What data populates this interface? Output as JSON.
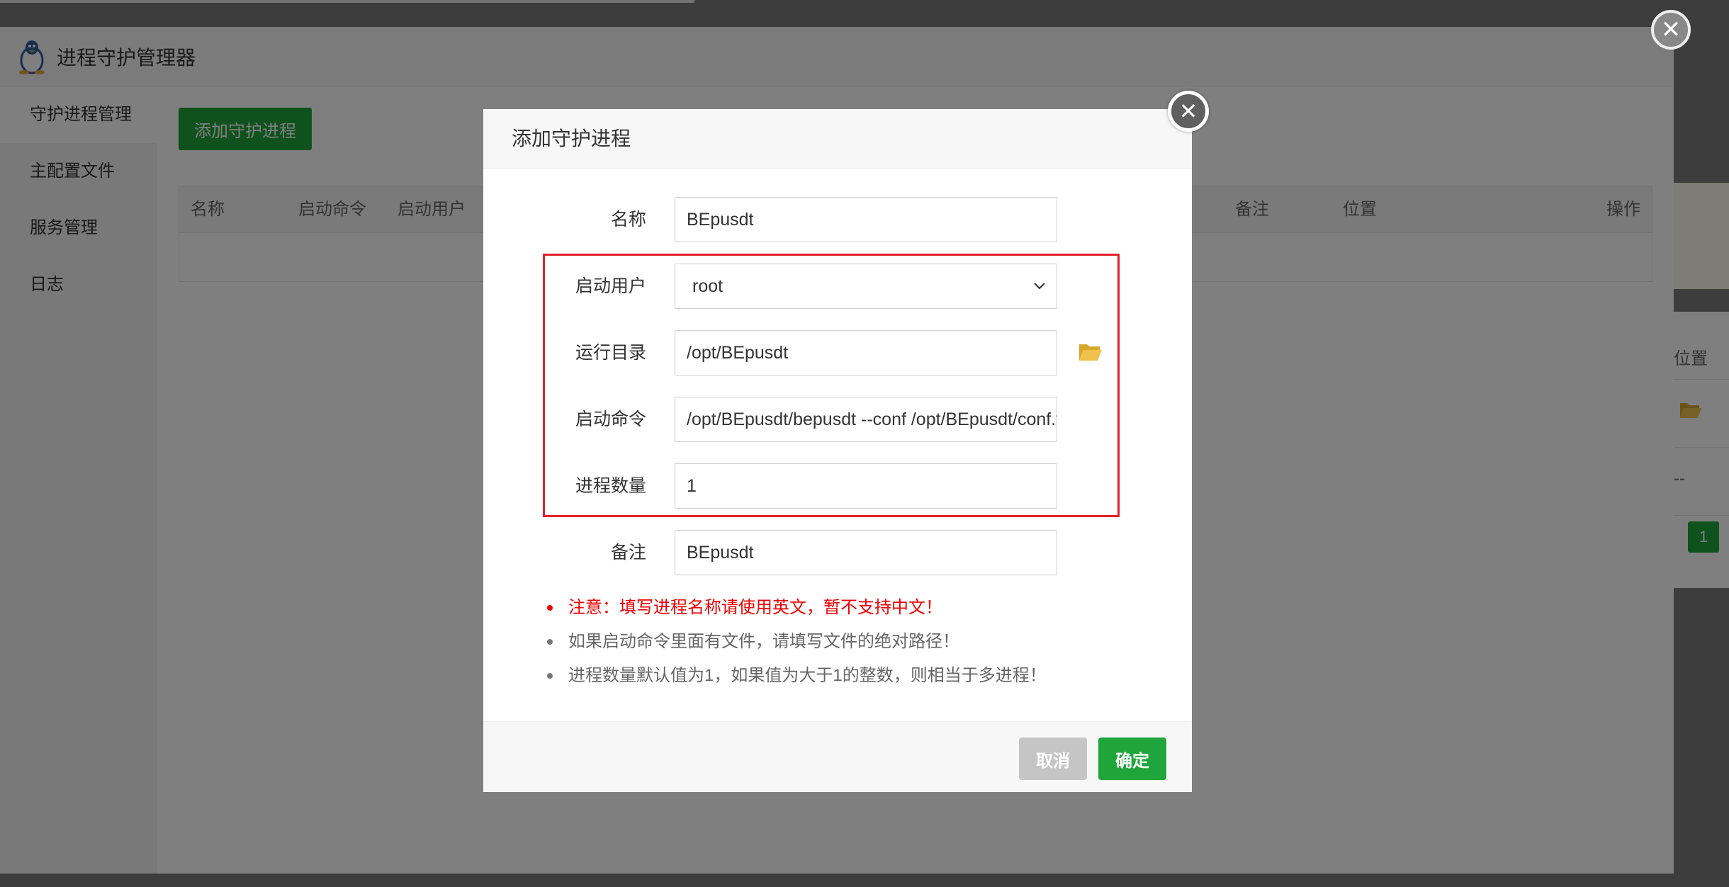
{
  "window": {
    "title": "进程守护管理器",
    "sidebar": [
      {
        "label": "守护进程管理",
        "active": true
      },
      {
        "label": "主配置文件"
      },
      {
        "label": "服务管理"
      },
      {
        "label": "日志"
      }
    ],
    "add_button": "添加守护进程",
    "table_headers": [
      "名称",
      "启动命令",
      "启动用户",
      "备注",
      "位置",
      "操作"
    ],
    "peek": {
      "header": "位置",
      "dash": "--",
      "page": "1"
    }
  },
  "dialog": {
    "title": "添加守护进程",
    "fields": {
      "name": {
        "label": "名称",
        "value": "BEpusdt"
      },
      "user": {
        "label": "启动用户",
        "value": "root"
      },
      "dir": {
        "label": "运行目录",
        "value": "/opt/BEpusdt"
      },
      "cmd": {
        "label": "启动命令",
        "value": "/opt/BEpusdt/bepusdt --conf /opt/BEpusdt/conf.toml"
      },
      "count": {
        "label": "进程数量",
        "value": "1"
      },
      "remark": {
        "label": "备注",
        "value": "BEpusdt"
      }
    },
    "tips": [
      "注意：填写进程名称请使用英文，暂不支持中文！",
      "如果启动命令里面有文件，请填写文件的绝对路径！",
      "进程数量默认值为1，如果值为大于1的整数，则相当于多进程！"
    ],
    "cancel": "取消",
    "ok": "确定"
  },
  "colors": {
    "accent": "#20a53a",
    "warn": "#e00000",
    "highlight_box": "#e0202a"
  },
  "icons": [
    "linux-tux-icon",
    "close-icon",
    "chevron-down-icon",
    "folder-open-icon"
  ]
}
